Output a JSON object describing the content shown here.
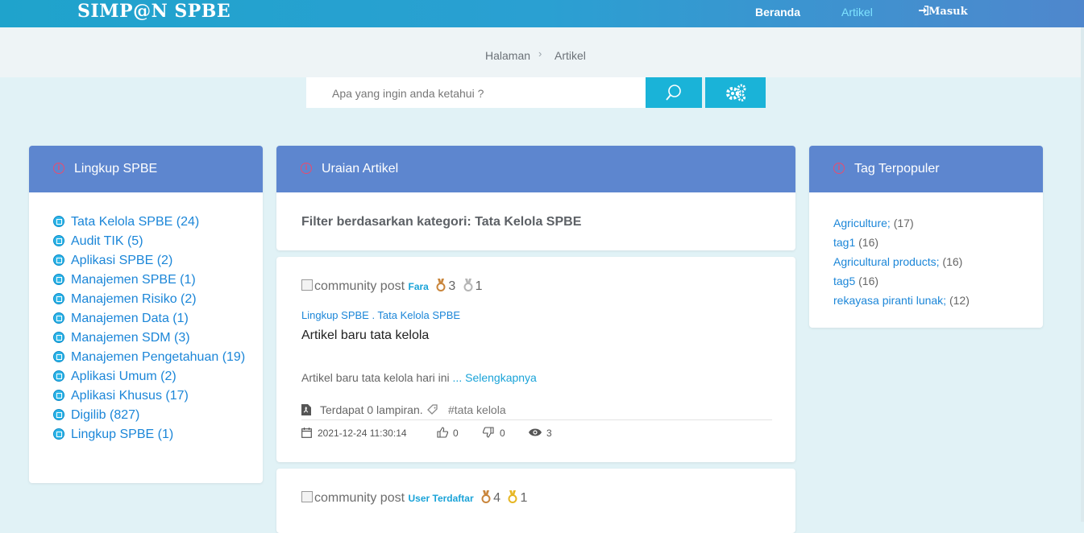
{
  "header": {
    "brand": "SIMP@N SPBE",
    "nav": {
      "home": "Beranda",
      "articles": "Artikel",
      "login": "Masuk"
    }
  },
  "breadcrumb": {
    "items": [
      "Halaman",
      "Artikel"
    ]
  },
  "search": {
    "placeholder": "Apa yang ingin anda ketahui ?"
  },
  "sidebar": {
    "title": "Lingkup SPBE",
    "items": [
      {
        "label": "Tata Kelola SPBE (24)"
      },
      {
        "label": "Audit TIK (5)"
      },
      {
        "label": "Aplikasi SPBE (2)"
      },
      {
        "label": "Manajemen SPBE (1)"
      },
      {
        "label": "Manajemen Risiko (2)"
      },
      {
        "label": "Manajemen Data (1)"
      },
      {
        "label": "Manajemen SDM (3)"
      },
      {
        "label": "Manajemen Pengetahuan (19)"
      },
      {
        "label": "Aplikasi Umum (2)"
      },
      {
        "label": "Aplikasi Khusus (17)"
      },
      {
        "label": "Digilib (827)"
      },
      {
        "label": "Lingkup SPBE (1)"
      }
    ]
  },
  "main": {
    "title": "Uraian Artikel",
    "filter": "Filter berdasarkan kategori: Tata Kelola SPBE",
    "posts": [
      {
        "img_alt": "community post",
        "author": "Fara",
        "medal1_count": "3",
        "medal2_count": "1",
        "category": "Lingkup SPBE . Tata Kelola SPBE",
        "title": "Artikel baru tata kelola",
        "excerpt": "Artikel baru tata kelola hari ini",
        "more": "... Selengkapnya",
        "attachments": "Terdapat 0 lampiran.",
        "tag": "#tata kelola",
        "date": "2021-12-24 11:30:14",
        "likes": "0",
        "dislikes": "0",
        "views": "3"
      },
      {
        "img_alt": "community post",
        "author": "User Terdaftar",
        "medal1_count": "4",
        "medal2_count": "1"
      }
    ]
  },
  "tags": {
    "title": "Tag Terpopuler",
    "items": [
      {
        "name": "Agriculture;",
        "count": "(17)"
      },
      {
        "name": "tag1",
        "count": "(16)"
      },
      {
        "name": "Agricultural products;",
        "count": "(16)"
      },
      {
        "name": "tag5",
        "count": "(16)"
      },
      {
        "name": "rekayasa piranti lunak;",
        "count": "(12)"
      }
    ]
  },
  "colors": {
    "header_start": "#1fa3cc",
    "header_end": "#4f87cd",
    "card_head": "#5d86cf",
    "accent": "#1ab3d8",
    "link": "#1b86d8",
    "info_icon": "#e84c6f"
  },
  "icons": [
    "search-icon",
    "cogs-icon",
    "login-icon",
    "info-icon",
    "category-icon",
    "medal-bronze-icon",
    "medal-silver-icon",
    "medal-gold-icon",
    "pdf-icon",
    "tag-icon",
    "calendar-icon",
    "thumbs-up-icon",
    "thumbs-down-icon",
    "eye-icon"
  ]
}
